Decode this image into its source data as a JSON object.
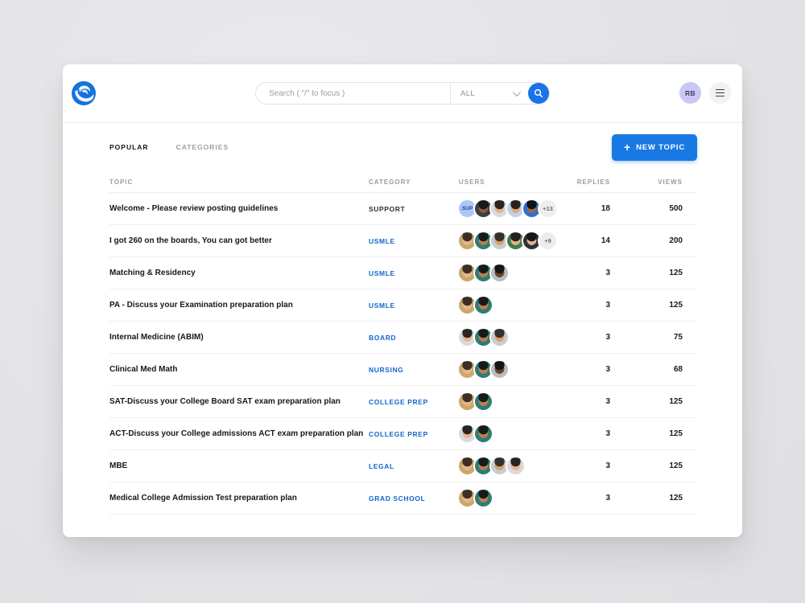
{
  "colors": {
    "accent_blue": "#1878E4",
    "category_default": "#1266C9",
    "category_support": "#2F3237",
    "page_bg": "#E5E5E8",
    "card_bg": "#FFFFFF"
  },
  "header": {
    "search_placeholder": "Search ( \"/\" to focus )",
    "search_filter": "ALL",
    "user_initials": "RB"
  },
  "tabs": {
    "popular": "POPULAR",
    "categories": "CATEGORIES"
  },
  "new_topic": {
    "icon": "+",
    "label": "NEW TOPIC"
  },
  "table": {
    "columns": {
      "topic": "TOPIC",
      "category": "CATEGORY",
      "users": "USERS",
      "replies": "REPLIES",
      "views": "VIEWS"
    },
    "rows": [
      {
        "topic": "Welcome - Please review posting guidelines",
        "category": "SUPPORT",
        "category_color": "#2F3237",
        "users": {
          "badge": "SUP",
          "photos": [
            "s1",
            "s2",
            "s3",
            "s4"
          ],
          "more": "+13"
        },
        "replies": "18",
        "views": "500"
      },
      {
        "topic": "I got 260 on the boards, You can got better",
        "category": "USMLE",
        "users": {
          "photos": [
            "s5",
            "s6",
            "s7",
            "s9",
            "s10"
          ],
          "more": "+9"
        },
        "replies": "14",
        "views": "200"
      },
      {
        "topic": "Matching & Residency",
        "category": "USMLE",
        "users": {
          "photos": [
            "s5",
            "s6",
            "s8"
          ]
        },
        "replies": "3",
        "views": "125"
      },
      {
        "topic": "PA - Discuss your Examination preparation plan",
        "category": "USMLE",
        "users": {
          "photos": [
            "s5",
            "s6"
          ]
        },
        "replies": "3",
        "views": "125"
      },
      {
        "topic": "Internal Medicine (ABIM)",
        "category": "BOARD",
        "users": {
          "photos": [
            "s2",
            "s6",
            "s7"
          ]
        },
        "replies": "3",
        "views": "75"
      },
      {
        "topic": "Clinical Med Math",
        "category": "NURSING",
        "users": {
          "photos": [
            "s5",
            "s6",
            "s8"
          ]
        },
        "replies": "3",
        "views": "68"
      },
      {
        "topic": "SAT-Discuss your College Board SAT exam preparation plan",
        "category": "COLLEGE PREP",
        "users": {
          "photos": [
            "s5",
            "s6"
          ]
        },
        "replies": "3",
        "views": "125"
      },
      {
        "topic": "ACT-Discuss your College admissions ACT exam preparation plan",
        "category": "COLLEGE PREP",
        "users": {
          "photos": [
            "s2",
            "s6"
          ]
        },
        "replies": "3",
        "views": "125"
      },
      {
        "topic": "MBE",
        "category": "LEGAL",
        "users": {
          "photos": [
            "s5",
            "s6",
            "s7",
            "s2"
          ]
        },
        "replies": "3",
        "views": "125"
      },
      {
        "topic": "Medical College Admission Test preparation plan",
        "category": "GRAD SCHOOL",
        "users": {
          "photos": [
            "s5",
            "s6"
          ]
        },
        "replies": "3",
        "views": "125"
      }
    ]
  },
  "avatar_styles": {
    "s1": {
      "bg": "#3A3F45",
      "skin": "#8A5A3B",
      "hair": "#17181A"
    },
    "s2": {
      "bg": "#D8DADE",
      "skin": "#E8B48E",
      "hair": "#2B2420"
    },
    "s3": {
      "bg": "#BCD2EE",
      "skin": "#E2A877",
      "hair": "#27211C"
    },
    "s4": {
      "bg": "#2E6FD0",
      "skin": "#9A6A45",
      "hair": "#101214"
    },
    "s5": {
      "bg": "#C9A86B",
      "skin": "#E7B68C",
      "hair": "#3C2E24"
    },
    "s6": {
      "bg": "#2E7D74",
      "skin": "#B97F4E",
      "hair": "#1C1A18"
    },
    "s7": {
      "bg": "#C9CCD1",
      "skin": "#D9A06E",
      "hair": "#35302A"
    },
    "s8": {
      "bg": "#B9BDC2",
      "skin": "#6B4326",
      "hair": "#141516"
    },
    "s9": {
      "bg": "#3F7D4E",
      "skin": "#E5B089",
      "hair": "#23201D"
    },
    "s10": {
      "bg": "#2F3136",
      "skin": "#DEB392",
      "hair": "#15161A"
    },
    "badge": {
      "bg": "#A9C8F8",
      "text": "#29418F"
    },
    "more": {
      "bg": "#EDEDEF",
      "text": "#6B6E73"
    }
  }
}
